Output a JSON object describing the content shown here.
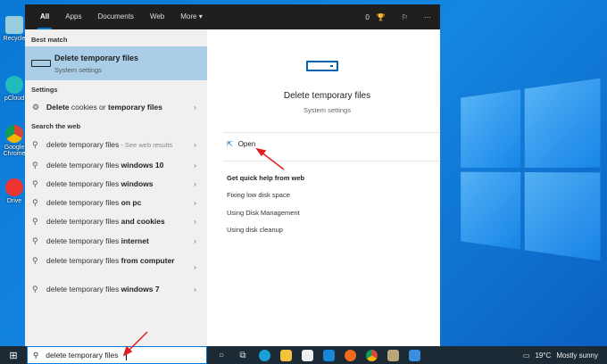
{
  "desktop": {
    "icons": [
      {
        "label": "Recycle",
        "color": "#9cd"
      },
      {
        "label": "pCloud",
        "color": "#2bb"
      },
      {
        "label": "Google Chrome",
        "color": "#db4437"
      },
      {
        "label": "Drive",
        "color": "#e33"
      }
    ]
  },
  "header": {
    "tabs": [
      "All",
      "Apps",
      "Documents",
      "Web",
      "More ▾"
    ],
    "points": "0"
  },
  "left": {
    "best_match_label": "Best match",
    "best": {
      "title": "Delete temporary files",
      "subtitle": "System settings"
    },
    "settings_label": "Settings",
    "settings_item": {
      "b1": "Delete",
      "n": " cookies or ",
      "b2": "temporary files"
    },
    "web_label": "Search the web",
    "web": [
      {
        "base": "delete temporary files",
        "bold": "",
        "hint": " - See web results"
      },
      {
        "base": "delete temporary files ",
        "bold": "windows 10"
      },
      {
        "base": "delete temporary files ",
        "bold": "windows"
      },
      {
        "base": "delete temporary files ",
        "bold": "on pc"
      },
      {
        "base": "delete temporary files ",
        "bold": "and cookies"
      },
      {
        "base": "delete temporary files ",
        "bold": "internet"
      },
      {
        "base": "delete temporary files ",
        "bold": "from computer"
      },
      {
        "base": "delete temporary files ",
        "bold": "windows 7"
      }
    ]
  },
  "right": {
    "title": "Delete temporary files",
    "subtitle": "System settings",
    "open": "Open",
    "quick_help": "Get quick help from web",
    "links": [
      "Fixing low disk space",
      "Using Disk Management",
      "Using disk cleanup"
    ]
  },
  "taskbar": {
    "search_value": "delete temporary files",
    "temperature": "19°C",
    "weather": "Mostly sunny"
  }
}
